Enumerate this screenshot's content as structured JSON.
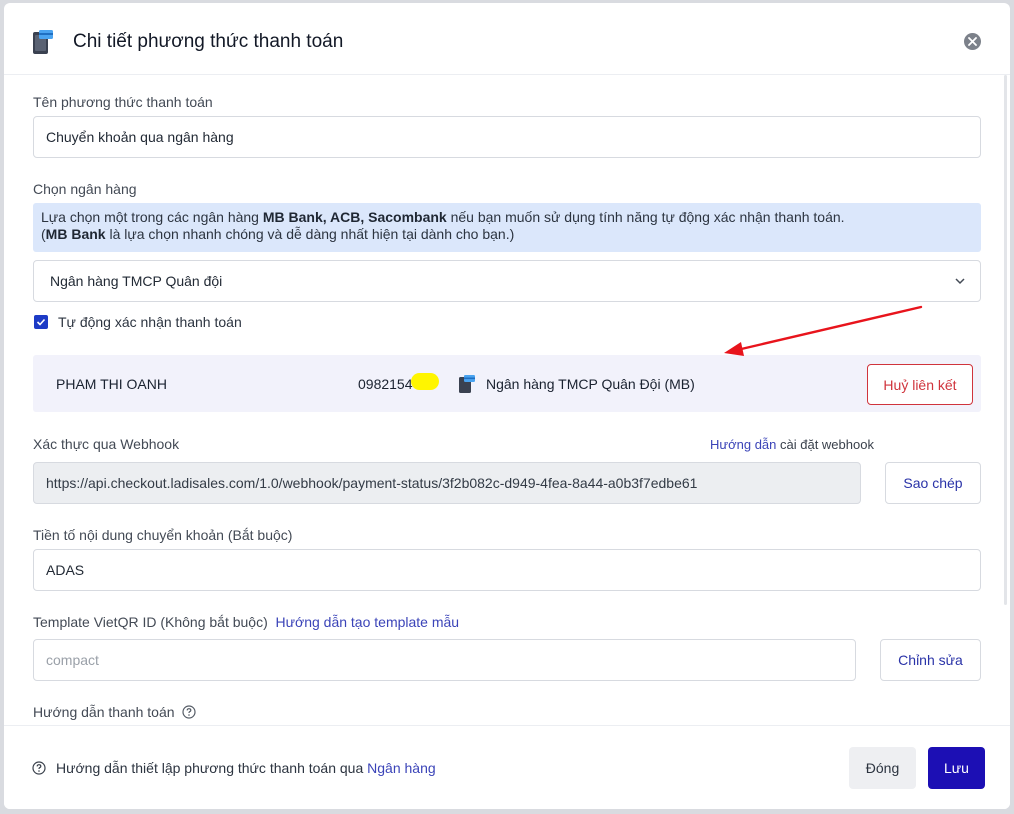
{
  "header": {
    "title": "Chi tiết phương thức thanh toán",
    "icon": "payment-card-icon"
  },
  "form": {
    "method_name": {
      "label": "Tên phương thức thanh toán",
      "value": "Chuyển khoản qua ngân hàng"
    },
    "bank_select": {
      "label": "Chọn ngân hàng",
      "info": {
        "line1_prefix": "Lựa chọn một trong các ngân hàng ",
        "line1_banks": "MB Bank, ACB, Sacombank",
        "line1_suffix": " nếu bạn muốn sử dụng tính năng tự động xác nhận thanh toán.",
        "line2_open": "(",
        "line2_bank": "MB Bank",
        "line2_suffix": " là lựa chọn nhanh chóng và dễ dàng nhất hiện tại dành cho bạn.)"
      },
      "selected": "Ngân hàng TMCP Quân đội"
    },
    "auto_confirm": {
      "label": "Tự động xác nhận thanh toán",
      "checked": true
    },
    "linked_account": {
      "name": "PHAM THI OANH",
      "phone": "0982154",
      "bank": "Ngân hàng TMCP Quân Đội (MB)",
      "unlink_label": "Huỷ liên kết"
    },
    "webhook": {
      "label": "Xác thực qua Webhook",
      "guide_link": "Hướng dẫn",
      "guide_rest": " cài đặt webhook",
      "url": "https://api.checkout.ladisales.com/1.0/webhook/payment-status/3f2b082c-d949-4fea-8a44-a0b3f7edbe61",
      "copy_label": "Sao chép"
    },
    "prefix": {
      "label": "Tiền tố nội dung chuyển khoản (Bắt buộc)",
      "value": "ADAS"
    },
    "vietqr": {
      "label": "Template VietQR ID (Không bắt buộc)",
      "guide_link": "Hướng dẫn tạo template mẫu",
      "placeholder": "compact",
      "edit_label": "Chỉnh sửa"
    },
    "payment_guide": {
      "label": "Hướng dẫn thanh toán"
    }
  },
  "footer": {
    "help_text": "Hướng dẫn thiết lập phương thức thanh toán qua ",
    "help_link": "Ngân hàng",
    "close_label": "Đóng",
    "save_label": "Lưu"
  },
  "colors": {
    "primary": "#1c0fb4",
    "danger": "#d0343c",
    "info_bg": "#dbe7fb",
    "annotation": "#e8141c"
  }
}
